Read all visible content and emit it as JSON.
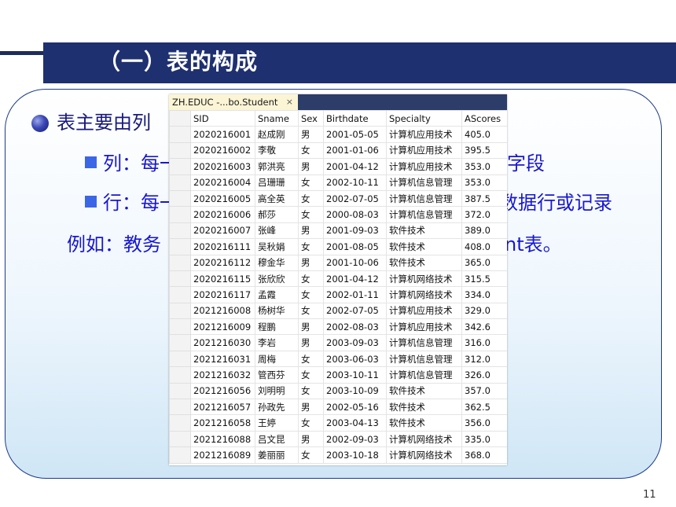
{
  "slide": {
    "title": "（一）表的构成",
    "page_number": "11"
  },
  "text": {
    "line1": "表主要由列",
    "line2_start": "列：每一",
    "line2_end": "字段",
    "line3_start": "行：每一",
    "line3_end": "数据行或记录",
    "line4_start": "例如：教务",
    "line4_end": "nt表。"
  },
  "table_window": {
    "tab_label": "ZH.EDUC -...bo.Student",
    "tab_close": "×",
    "columns": [
      "SID",
      "Sname",
      "Sex",
      "Birthdate",
      "Specialty",
      "AScores"
    ],
    "rows": [
      [
        "2020216001",
        "赵成刚",
        "男",
        "2001-05-05",
        "计算机应用技术",
        "405.0"
      ],
      [
        "2020216002",
        "李敬",
        "女",
        "2001-01-06",
        "计算机应用技术",
        "395.5"
      ],
      [
        "2020216003",
        "郭洪亮",
        "男",
        "2001-04-12",
        "计算机应用技术",
        "353.0"
      ],
      [
        "2020216004",
        "吕珊珊",
        "女",
        "2002-10-11",
        "计算机信息管理",
        "353.0"
      ],
      [
        "2020216005",
        "高全英",
        "女",
        "2002-07-05",
        "计算机信息管理",
        "387.5"
      ],
      [
        "2020216006",
        "郝莎",
        "女",
        "2000-08-03",
        "计算机信息管理",
        "372.0"
      ],
      [
        "2020216007",
        "张峰",
        "男",
        "2001-09-03",
        "软件技术",
        "389.0"
      ],
      [
        "2020216111",
        "吴秋娟",
        "女",
        "2001-08-05",
        "软件技术",
        "408.0"
      ],
      [
        "2020216112",
        "穆金华",
        "男",
        "2001-10-06",
        "软件技术",
        "365.0"
      ],
      [
        "2020216115",
        "张欣欣",
        "女",
        "2001-04-12",
        "计算机网络技术",
        "315.5"
      ],
      [
        "2020216117",
        "孟霞",
        "女",
        "2002-01-11",
        "计算机网络技术",
        "334.0"
      ],
      [
        "2021216008",
        "杨树华",
        "女",
        "2002-07-05",
        "计算机应用技术",
        "329.0"
      ],
      [
        "2021216009",
        "程鹏",
        "男",
        "2002-08-03",
        "计算机应用技术",
        "342.6"
      ],
      [
        "2021216030",
        "李岩",
        "男",
        "2003-09-03",
        "计算机信息管理",
        "316.0"
      ],
      [
        "2021216031",
        "周梅",
        "女",
        "2003-06-03",
        "计算机信息管理",
        "312.0"
      ],
      [
        "2021216032",
        "管西芬",
        "女",
        "2003-10-11",
        "计算机信息管理",
        "326.0"
      ],
      [
        "2021216056",
        "刘明明",
        "女",
        "2003-10-09",
        "软件技术",
        "357.0"
      ],
      [
        "2021216057",
        "孙政先",
        "男",
        "2002-05-16",
        "软件技术",
        "362.5"
      ],
      [
        "2021216058",
        "王婷",
        "女",
        "2003-04-13",
        "软件技术",
        "356.0"
      ],
      [
        "2021216088",
        "吕文昆",
        "男",
        "2002-09-03",
        "计算机网络技术",
        "335.0"
      ],
      [
        "2021216089",
        "姜丽丽",
        "女",
        "2003-10-18",
        "计算机网络技术",
        "368.0"
      ]
    ]
  },
  "colors": {
    "header_bar": "#1e3070",
    "body_text": "#1818cc",
    "bullet_square": "#3b66e6"
  }
}
